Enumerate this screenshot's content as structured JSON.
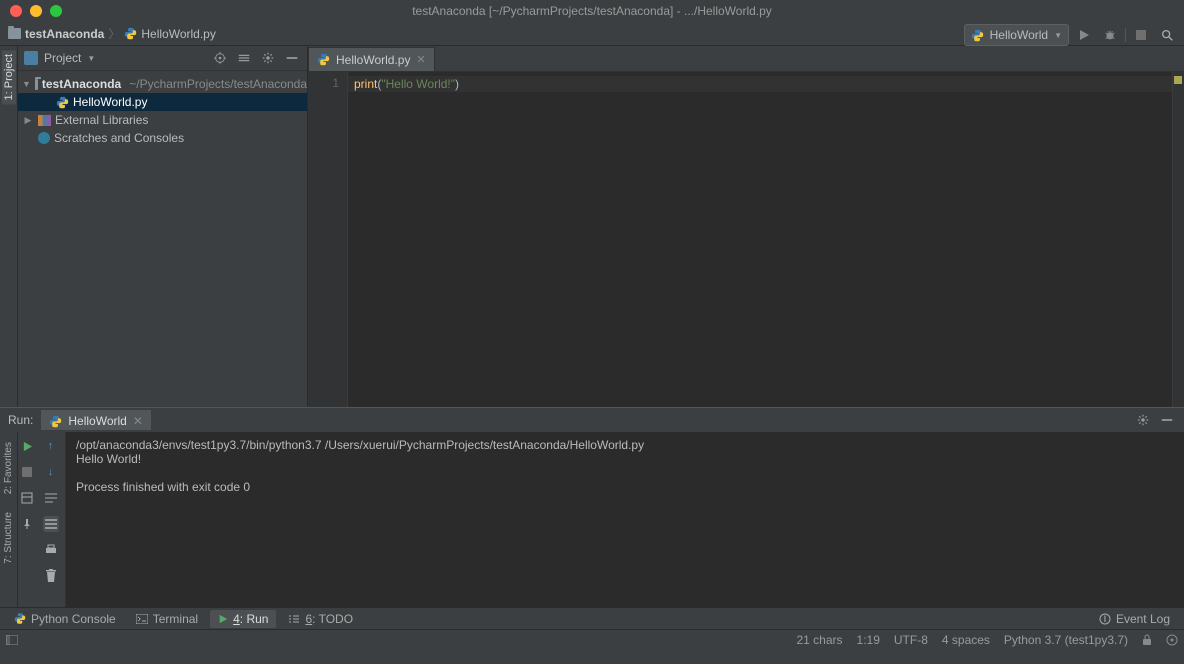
{
  "window": {
    "title": "testAnaconda [~/PycharmProjects/testAnaconda] - .../HelloWorld.py"
  },
  "breadcrumb": {
    "project": "testAnaconda",
    "file": "HelloWorld.py"
  },
  "run_config": {
    "selected": "HelloWorld"
  },
  "sidebar_header": {
    "title": "Project"
  },
  "tree": {
    "root": {
      "name": "testAnaconda",
      "path": "~/PycharmProjects/testAnaconda"
    },
    "file1": "HelloWorld.py",
    "external": "External Libraries",
    "scratches": "Scratches and Consoles"
  },
  "editor": {
    "tab": "HelloWorld.py",
    "gutter": {
      "l1": "1"
    },
    "code": {
      "fn": "print",
      "open": "(",
      "str": "\"Hello World!\"",
      "close": ")"
    }
  },
  "left_tabs": {
    "project": "1: Project",
    "favorites": "2: Favorites",
    "structure": "7: Structure"
  },
  "run": {
    "label": "Run:",
    "tab": "HelloWorld",
    "line1": "/opt/anaconda3/envs/test1py3.7/bin/python3.7 /Users/xuerui/PycharmProjects/testAnaconda/HelloWorld.py",
    "line2": "Hello World!",
    "line3": "",
    "line4": "Process finished with exit code 0"
  },
  "bottom_tabs": {
    "python_console": "Python Console",
    "terminal": "Terminal",
    "run": "4: Run",
    "todo": "6: TODO",
    "event_log": "Event Log"
  },
  "status": {
    "chars": "21 chars",
    "pos": "1:19",
    "encoding": "UTF-8",
    "indent": "4 spaces",
    "interpreter": "Python 3.7 (test1py3.7)"
  }
}
